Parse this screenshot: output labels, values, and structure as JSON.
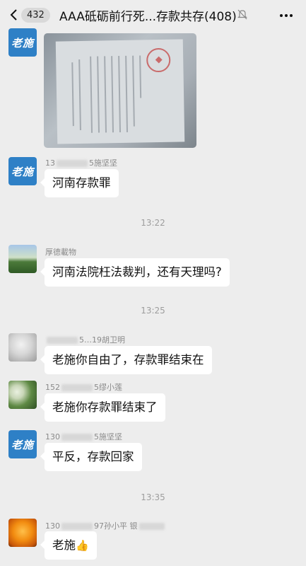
{
  "header": {
    "unread_count": "432",
    "title": "AAA砥砺前行死...存款共存(408)"
  },
  "messages": [
    {
      "type": "image",
      "avatar_text": "老施"
    },
    {
      "sender": "13",
      "sender_tail": "5施坚坚",
      "text": "河南存款罪",
      "avatar_text": "老施"
    },
    {
      "type": "time",
      "text": "13:22"
    },
    {
      "sender": "厚德載物",
      "text": "河南法院枉法裁判，还有天理吗?"
    },
    {
      "type": "time",
      "text": "13:25"
    },
    {
      "sender": "",
      "sender_tail": "5…19胡卫明",
      "text": "老施你自由了，存款罪结束在"
    },
    {
      "sender": "152",
      "sender_tail": "5缪小莲",
      "text": "老施你存款罪结束了"
    },
    {
      "sender": "130",
      "sender_tail": "5施坚坚",
      "text": "平反，存款回家",
      "avatar_text": "老施"
    },
    {
      "type": "time",
      "text": "13:35"
    },
    {
      "sender": "130",
      "sender_tail": "97孙小平 银",
      "text": "老施"
    }
  ]
}
